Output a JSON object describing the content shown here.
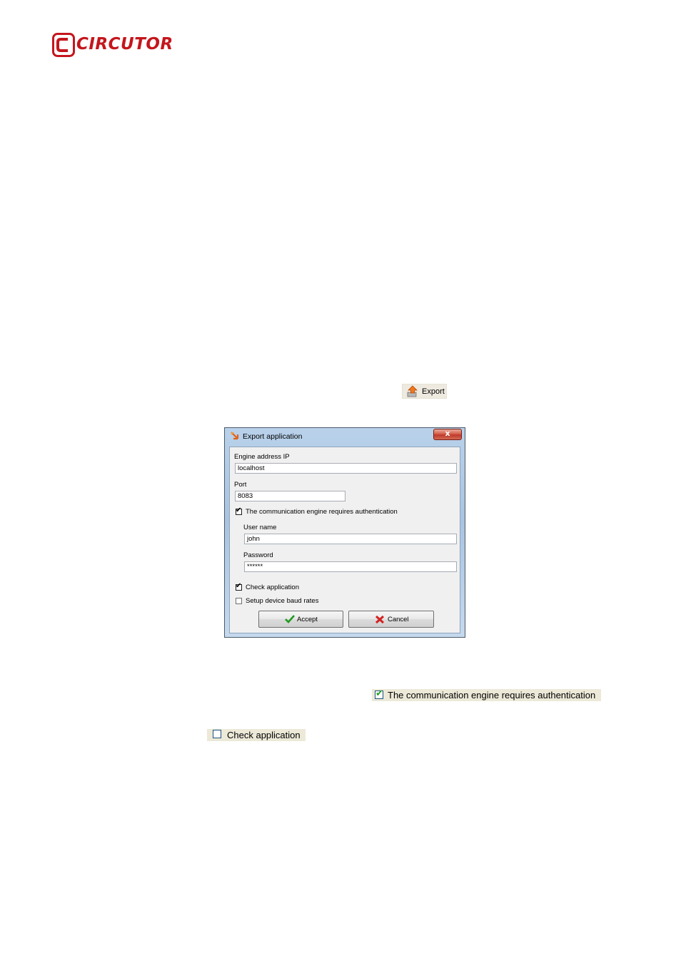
{
  "logo": {
    "text": "CIRCUTOR",
    "brand_color": "#c4161c"
  },
  "export_button": {
    "label": "Export",
    "icon": "export-arrow-icon"
  },
  "dialog": {
    "title": "Export application",
    "close_label": "x",
    "engine_address_label": "Engine address IP",
    "engine_address_value": "localhost",
    "port_label": "Port",
    "port_value": "8083",
    "auth_label": "The communication engine requires authentication",
    "auth_checked": true,
    "user_label": "User name",
    "user_value": "john",
    "password_label": "Password",
    "password_value": "******",
    "check_app_label": "Check application",
    "check_app_checked": true,
    "baud_label": "Setup device baud rates",
    "baud_checked": false,
    "accept_label": "Accept",
    "cancel_label": "Cancel"
  },
  "captures": {
    "auth_label": "The communication engine requires authentication",
    "auth_checked": true,
    "check_app_label": "Check application",
    "check_app_checked": false
  }
}
